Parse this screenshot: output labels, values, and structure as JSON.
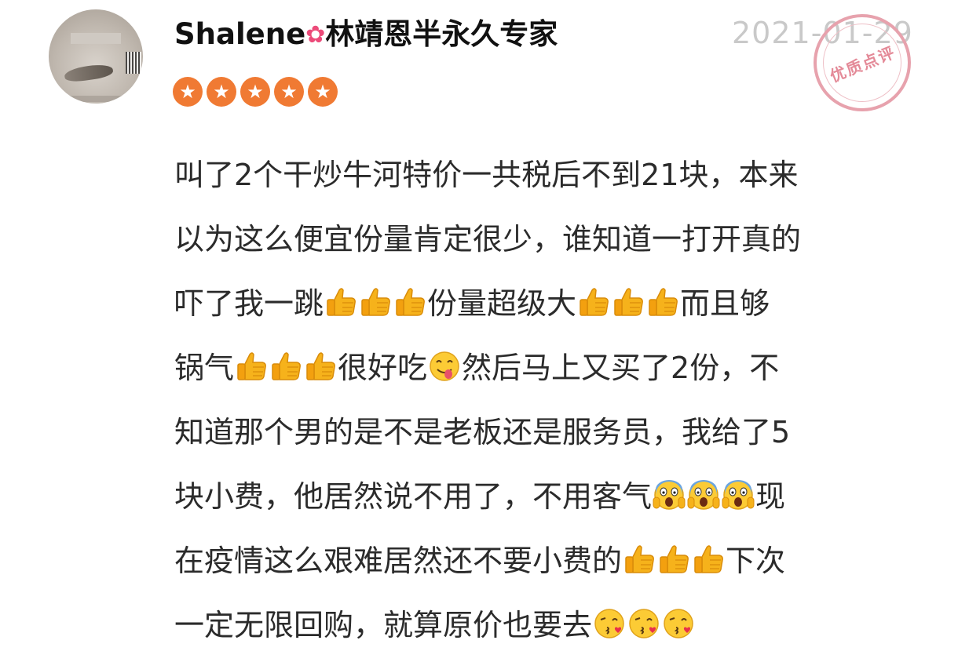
{
  "header": {
    "username": "Shalene",
    "username_suffix": "林靖恩半永久专家",
    "flower_icon": "hibiscus-flower-icon",
    "date": "2021-01-29",
    "rating": 5,
    "stamp_text": "优质点评"
  },
  "review": {
    "lines": [
      [
        "叫了2个干炒牛河特价一共税后不到21块，本来"
      ],
      [
        "以为这么便宜份量肯定很少，谁知道一打开真的"
      ],
      [
        "吓了我一跳",
        "thumbs-up",
        "thumbs-up",
        "thumbs-up",
        "份量超级大",
        "thumbs-up",
        "thumbs-up",
        "thumbs-up",
        "而且够"
      ],
      [
        "锅气",
        "thumbs-up",
        "thumbs-up",
        "thumbs-up",
        "很好吃",
        "yum-face",
        "然后马上又买了2份，不"
      ],
      [
        "知道那个男的是不是老板还是服务员，我给了5"
      ],
      [
        "块小费，他居然说不用了，不用客气",
        "scream-face",
        "scream-face",
        "scream-face",
        "现"
      ],
      [
        "在疫情这么艰难居然还不要小费的",
        "thumbs-up",
        "thumbs-up",
        "thumbs-up",
        "下次"
      ],
      [
        "一定无限回购，就算原价也要去",
        "kiss-face",
        "kiss-face",
        "kiss-face"
      ]
    ]
  },
  "colors": {
    "star": "#f07a33",
    "stamp": "#e48a98",
    "date": "#c9c9c9"
  }
}
